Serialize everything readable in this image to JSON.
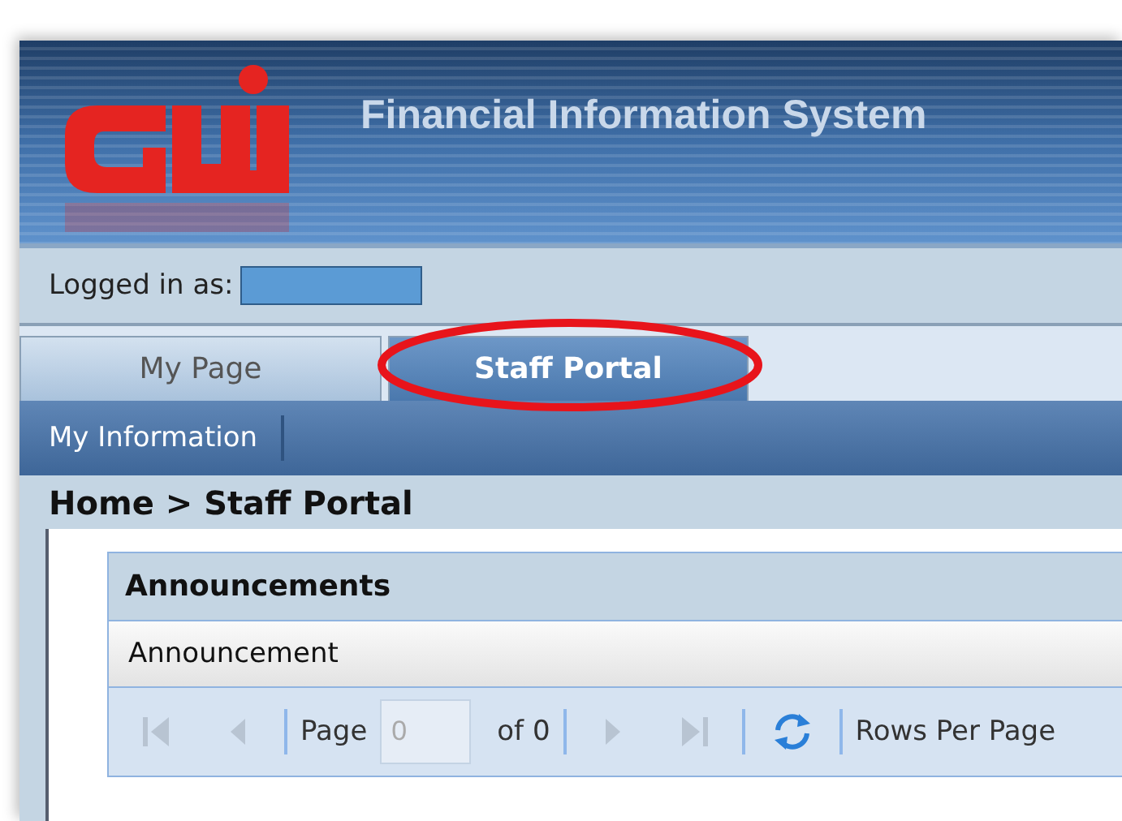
{
  "header": {
    "title": "Financial Information System"
  },
  "login": {
    "label": "Logged in as:"
  },
  "tabs": [
    {
      "label": "My Page",
      "selected": false
    },
    {
      "label": "Staff Portal",
      "selected": true,
      "highlighted": true
    }
  ],
  "nav": {
    "items": [
      "My Information"
    ]
  },
  "breadcrumb": "Home > Staff Portal",
  "panel": {
    "title": "Announcements",
    "columns": [
      "Announcement"
    ],
    "pager": {
      "page_label": "Page",
      "page_value": "0",
      "of_label": "of 0",
      "rows_label": "Rows Per Page",
      "disabled": true
    }
  }
}
